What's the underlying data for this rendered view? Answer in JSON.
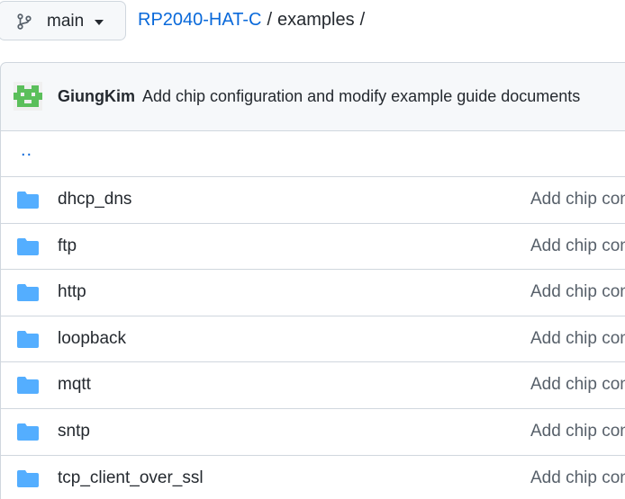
{
  "branch": {
    "label": "main",
    "icon": "git-branch-icon"
  },
  "breadcrumb": {
    "repo": "RP2040-HAT-C",
    "sep1": "/",
    "dir": "examples",
    "sep2": "/"
  },
  "commit": {
    "author": "GiungKim",
    "message": "Add chip configuration and modify example guide documents",
    "avatar_color": "#5bbf5b"
  },
  "parent_link": "..",
  "colors": {
    "link": "#0969da",
    "folder": "#54aeff"
  },
  "items": [
    {
      "name": "dhcp_dns",
      "commit": "Add chip con",
      "icon": "folder-icon"
    },
    {
      "name": "ftp",
      "commit": "Add chip con",
      "icon": "folder-icon"
    },
    {
      "name": "http",
      "commit": "Add chip con",
      "icon": "folder-icon"
    },
    {
      "name": "loopback",
      "commit": "Add chip con",
      "icon": "folder-icon"
    },
    {
      "name": "mqtt",
      "commit": "Add chip con",
      "icon": "folder-icon"
    },
    {
      "name": "sntp",
      "commit": "Add chip con",
      "icon": "folder-icon"
    },
    {
      "name": "tcp_client_over_ssl",
      "commit": "Add chip con",
      "icon": "folder-icon"
    }
  ]
}
